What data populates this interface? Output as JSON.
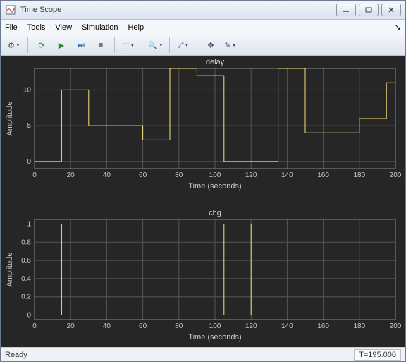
{
  "window": {
    "title": "Time Scope"
  },
  "menu": {
    "file": "File",
    "tools": "Tools",
    "view": "View",
    "simulation": "Simulation",
    "help": "Help"
  },
  "status": {
    "ready": "Ready",
    "time": "T=195.000"
  },
  "chart_data": [
    {
      "type": "line",
      "stepped": true,
      "title": "delay",
      "xlabel": "Time (seconds)",
      "ylabel": "Amplitude",
      "xlim": [
        0,
        200
      ],
      "ylim": [
        -1,
        13
      ],
      "xticks": [
        0,
        20,
        40,
        60,
        80,
        100,
        120,
        140,
        160,
        180,
        200
      ],
      "yticks": [
        0,
        5,
        10
      ],
      "series": [
        {
          "name": "delay",
          "x": [
            0,
            15,
            30,
            45,
            60,
            75,
            90,
            105,
            120,
            135,
            150,
            165,
            180,
            195
          ],
          "y": [
            0,
            10,
            5,
            5,
            3,
            13,
            12,
            0,
            0,
            13,
            4,
            4,
            6,
            11
          ]
        }
      ]
    },
    {
      "type": "line",
      "stepped": true,
      "title": "chg",
      "xlabel": "Time (seconds)",
      "ylabel": "Amplitude",
      "xlim": [
        0,
        200
      ],
      "ylim": [
        -0.05,
        1.05
      ],
      "xticks": [
        0,
        20,
        40,
        60,
        80,
        100,
        120,
        140,
        160,
        180,
        200
      ],
      "yticks": [
        0,
        0.2,
        0.4,
        0.6,
        0.8,
        1
      ],
      "series": [
        {
          "name": "chg",
          "x": [
            0,
            15,
            30,
            45,
            60,
            75,
            90,
            105,
            120,
            135,
            150,
            165,
            180,
            195
          ],
          "y": [
            0,
            1,
            1,
            1,
            1,
            1,
            1,
            0,
            1,
            1,
            1,
            1,
            1,
            1
          ]
        }
      ]
    }
  ]
}
